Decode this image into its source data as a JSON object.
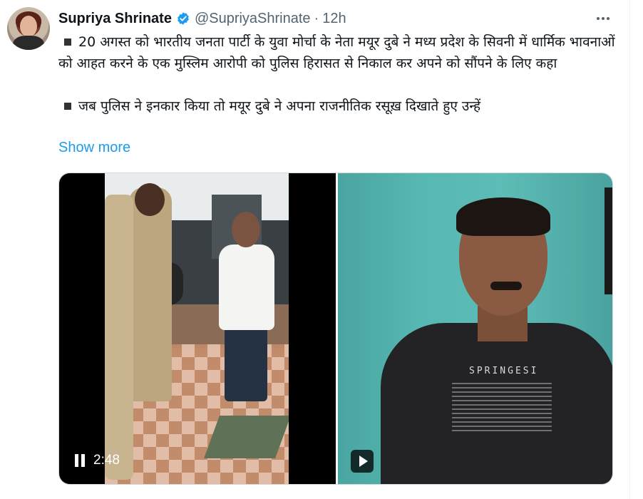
{
  "author": {
    "name": "Supriya Shrinate",
    "handle": "@SupriyaShrinate",
    "separator": "·",
    "time": "12h"
  },
  "tweet": {
    "paragraphs": [
      "20 अगस्त को भारतीय जनता पार्टी के युवा मोर्चा के नेता मयूर दुबे ने मध्य प्रदेश के सिवनी में धार्मिक भावनाओं को आहत करने के एक मुस्लिम आरोपी को पुलिस हिरासत से निकाल कर अपने को सौंपने के लिए कहा",
      "जब पुलिस ने इनकार किया तो मयूर दुबे ने अपना राजनीतिक रसूख़ दिखाते हुए उन्हें"
    ],
    "show_more": "Show more"
  },
  "media": {
    "video_duration": "2:48",
    "shirt_brand": "SPRINGESI"
  },
  "colors": {
    "link": "#1d9bf0",
    "verified": "#1d9bf0",
    "secondary_text": "#536471"
  },
  "icons": [
    "verified-badge-icon",
    "more-options-icon",
    "pause-icon",
    "play-icon"
  ]
}
